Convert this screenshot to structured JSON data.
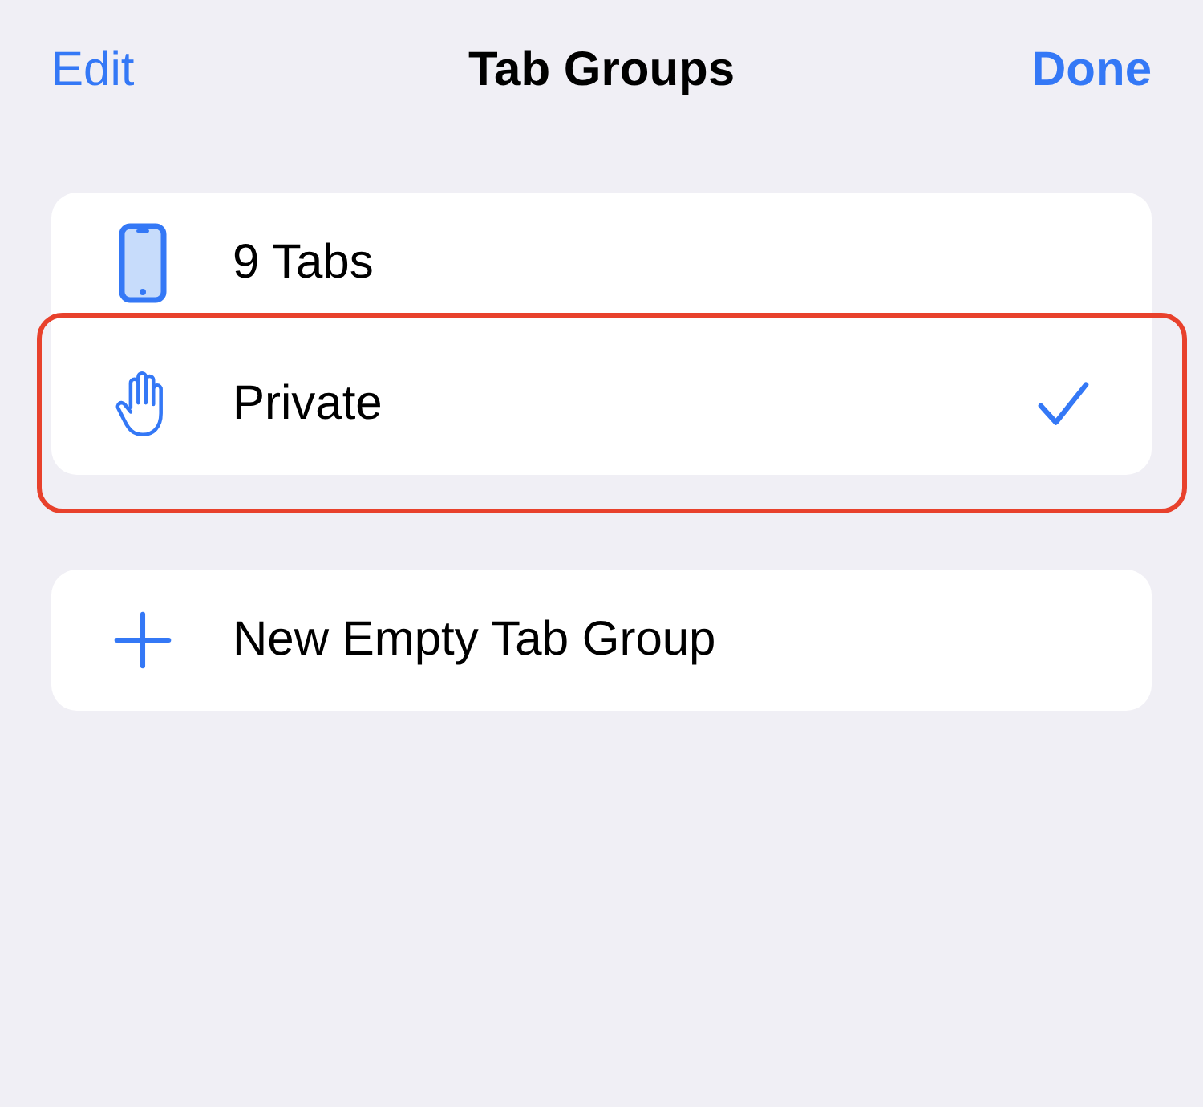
{
  "nav": {
    "left": "Edit",
    "title": "Tab Groups",
    "right": "Done"
  },
  "groups": [
    {
      "kind": "device",
      "label": "9 Tabs",
      "selected": false,
      "highlighted": false
    },
    {
      "kind": "private",
      "label": "Private",
      "selected": true,
      "highlighted": true
    }
  ],
  "actions": [
    {
      "kind": "add",
      "label": "New Empty Tab Group"
    }
  ]
}
